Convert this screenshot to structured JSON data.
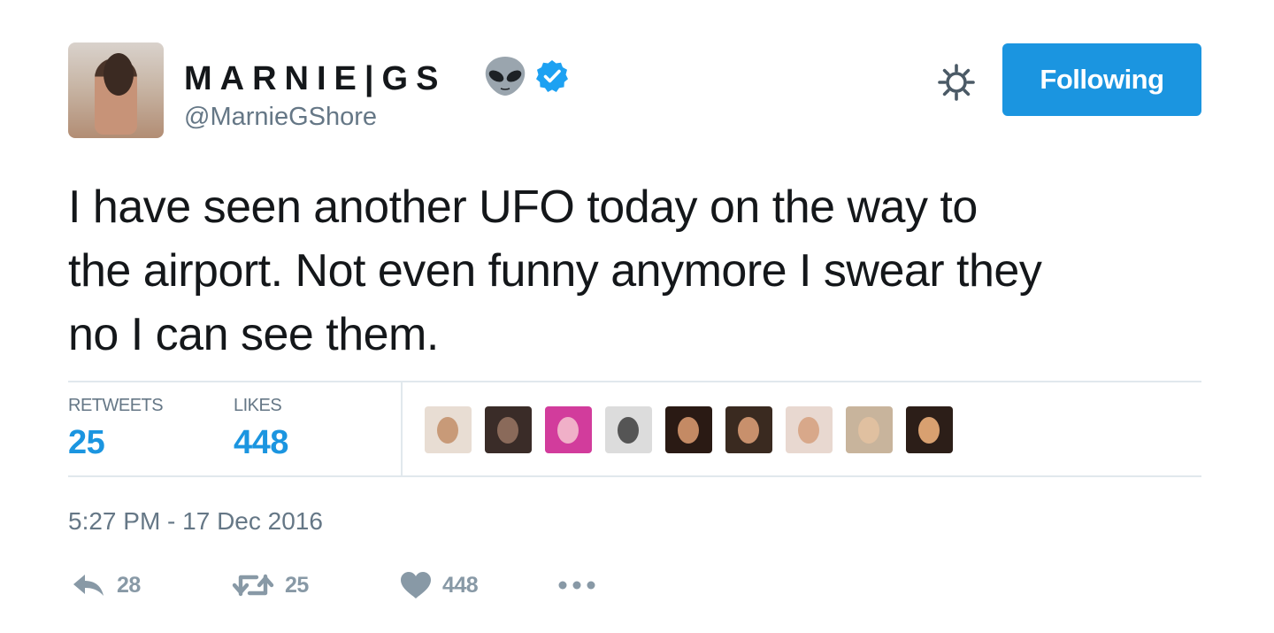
{
  "tweet": {
    "display_name": "MARNIE|GS",
    "handle": "@MarnieGShore",
    "follow_button_label": "Following",
    "text": "I have seen another UFO today on the way to the airport. Not even funny anymore I swear they no I can see them.",
    "text_lines": [
      "I have seen another UFO today on the way to",
      "the airport. Not even funny anymore I swear they",
      "no I can see them."
    ],
    "stats": {
      "retweets_label": "RETWEETS",
      "retweets_value": "25",
      "likes_label": "LIKES",
      "likes_value": "448"
    },
    "timestamp": "5:27 PM - 17 Dec 2016",
    "actions": {
      "reply_count": "28",
      "retweet_count": "25",
      "like_count": "448"
    },
    "likers": [
      {
        "name": "liker-1",
        "bg": "#e8ddd3",
        "face": "#c89a78"
      },
      {
        "name": "liker-2",
        "bg": "#3a2c28",
        "face": "#8a6a5a"
      },
      {
        "name": "liker-3",
        "bg": "#d23c9c",
        "face": "#f0b0c8"
      },
      {
        "name": "liker-4",
        "bg": "#dcdcdc",
        "face": "#555555"
      },
      {
        "name": "liker-5",
        "bg": "#2a1a14",
        "face": "#c48a64"
      },
      {
        "name": "liker-6",
        "bg": "#3a2a20",
        "face": "#c8906c"
      },
      {
        "name": "liker-7",
        "bg": "#e8d8d0",
        "face": "#d8a88a"
      },
      {
        "name": "liker-8",
        "bg": "#c8b49c",
        "face": "#e0c0a0"
      },
      {
        "name": "liker-9",
        "bg": "#2c1e18",
        "face": "#d8a070"
      }
    ],
    "colors": {
      "accent": "#1b95e0",
      "muted": "#657786",
      "icon_gray": "#8899a6",
      "verified": "#1da1f2"
    },
    "icons": [
      "alien-emoji-icon",
      "verified-badge-icon",
      "gear-icon",
      "reply-icon",
      "retweet-icon",
      "heart-icon",
      "more-dots-icon"
    ]
  }
}
